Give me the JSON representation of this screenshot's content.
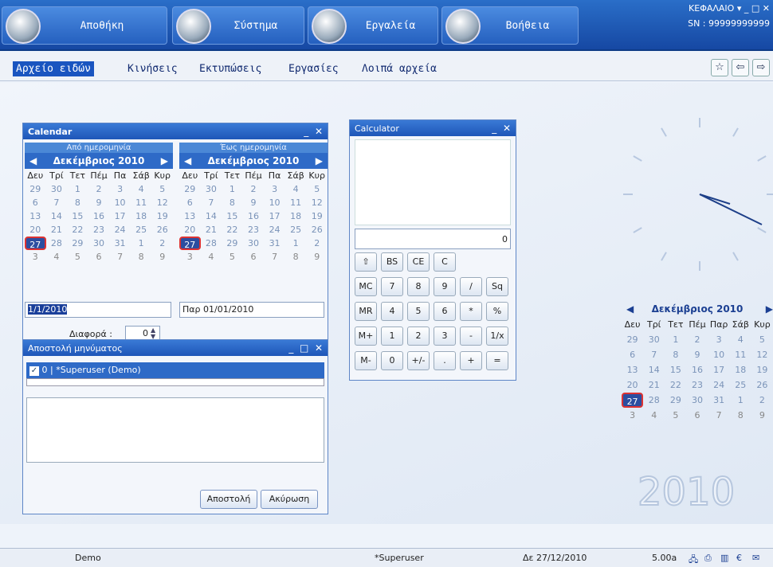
{
  "topbar": {
    "buttons": [
      {
        "label": "Αποθήκη",
        "icon": "warehouse-icon"
      },
      {
        "label": "Σύστημα",
        "icon": "monitor-icon"
      },
      {
        "label": "Εργαλεία",
        "icon": "calculator-icon"
      },
      {
        "label": "Βοήθεια",
        "icon": "help-icon"
      }
    ],
    "company": "ΚΕΦΑΛΑΙΟ",
    "serial": "SN : 99999999999"
  },
  "menu": {
    "items": [
      "Αρχείο ειδών",
      "Κινήσεις",
      "Εκτυπώσεις",
      "Εργασίες",
      "Λοιπά αρχεία"
    ]
  },
  "calendar": {
    "title": "Calendar",
    "from_label": "Από ημερομηνία",
    "to_label": "Έως ημερομηνία",
    "month": "Δεκέμβριος 2010",
    "weekdays": [
      "Δευ",
      "Τρί",
      "Τετ",
      "Πέμ",
      "Πα",
      "Σάβ",
      "Κυρ"
    ],
    "days": [
      "29",
      "30",
      "1",
      "2",
      "3",
      "4",
      "5",
      "6",
      "7",
      "8",
      "9",
      "10",
      "11",
      "12",
      "13",
      "14",
      "15",
      "16",
      "17",
      "18",
      "19",
      "20",
      "21",
      "22",
      "23",
      "24",
      "25",
      "26",
      "27",
      "28",
      "29",
      "30",
      "31",
      "1",
      "2",
      "3",
      "4",
      "5",
      "6",
      "7",
      "8",
      "9"
    ],
    "from_value": "1/1/2010",
    "to_value": "Παρ 01/01/2010",
    "diff_label": "Διαφορά :",
    "diff_value": "0"
  },
  "calculator": {
    "title": "Calculator",
    "display": "0",
    "rows": [
      [
        "⇧",
        "BS",
        "CE",
        "C"
      ],
      [
        "MC",
        "7",
        "8",
        "9",
        "/",
        "Sq"
      ],
      [
        "MR",
        "4",
        "5",
        "6",
        "*",
        "%"
      ],
      [
        "M+",
        "1",
        "2",
        "3",
        "-",
        "1/x"
      ],
      [
        "M-",
        "0",
        "+/-",
        ".",
        "+",
        "="
      ]
    ]
  },
  "message": {
    "title": "Αποστολή μηνύματος",
    "recipient_id": "0",
    "recipient": "*Superuser (Demo)",
    "send": "Αποστολή",
    "cancel": "Ακύρωση"
  },
  "desktop": {
    "month": "Δεκέμβριος 2010",
    "weekdays": [
      "Δευ",
      "Τρί",
      "Τετ",
      "Πέμ",
      "Παρ",
      "Σάβ",
      "Κυρ"
    ],
    "year": "2010"
  },
  "status": {
    "user": "Demo",
    "login": "*Superuser",
    "date": "Δε 27/12/2010",
    "version": "5.00a"
  }
}
